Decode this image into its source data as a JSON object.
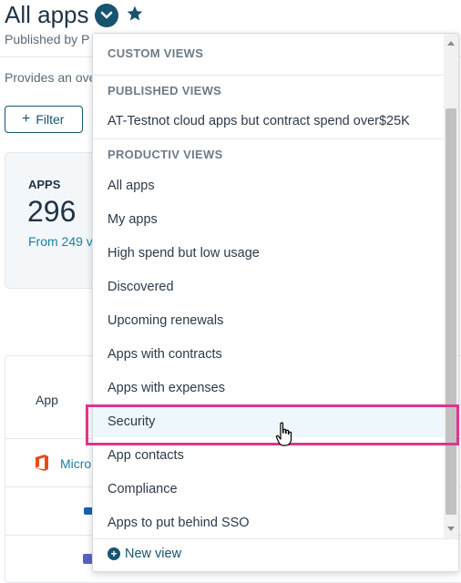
{
  "header": {
    "title": "All apps",
    "published_by": "Published by P",
    "description": "Provides an ove"
  },
  "toolbar": {
    "filter_label": "Filter"
  },
  "apps_card": {
    "label": "APPS",
    "count": "296",
    "from_text": "From 249 v"
  },
  "table": {
    "column_app": "App",
    "row1_name": "Micro"
  },
  "dropdown": {
    "custom_views_header": "CUSTOM VIEWS",
    "published_views_header": "PUBLISHED VIEWS",
    "published_views": [
      "AT-Testnot cloud apps but contract spend over$25K"
    ],
    "productiv_views_header": "PRODUCTIV VIEWS",
    "productiv_views": [
      "All apps",
      "My apps",
      "High spend but low usage",
      "Discovered",
      "Upcoming renewals",
      "Apps with contracts",
      "Apps with expenses",
      "Security",
      "App contacts",
      "Compliance",
      "Apps to put behind SSO"
    ],
    "selected_item": "Security",
    "new_view_label": "New view"
  },
  "colors": {
    "brand": "#17546f",
    "link": "#1a7fa6",
    "highlight": "#e0338f"
  }
}
